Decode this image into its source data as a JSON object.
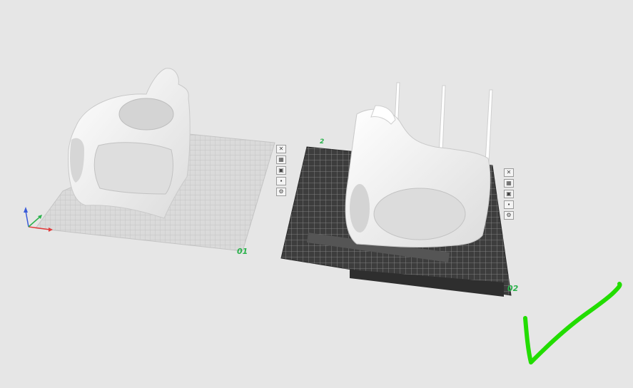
{
  "plates": [
    {
      "label": "01",
      "tools": [
        {
          "icon": "close-icon",
          "glyph": "✕"
        },
        {
          "icon": "arrange-icon",
          "glyph": "▦"
        },
        {
          "icon": "orient-icon",
          "glyph": "▣"
        },
        {
          "icon": "lock-icon",
          "glyph": "▪"
        },
        {
          "icon": "settings-icon",
          "glyph": "⚙"
        }
      ]
    },
    {
      "label": "02",
      "small_mark": "2",
      "tools": [
        {
          "icon": "close-icon",
          "glyph": "✕"
        },
        {
          "icon": "arrange-icon",
          "glyph": "▦"
        },
        {
          "icon": "orient-icon",
          "glyph": "▣"
        },
        {
          "icon": "lock-icon",
          "glyph": "▪"
        },
        {
          "icon": "settings-icon",
          "glyph": "⚙"
        }
      ]
    }
  ],
  "colors": {
    "background": "#e6e6e6",
    "plate_label": "#2bb24c",
    "checkmark": "#22dd00",
    "plate1_grid": "#d2d2d2",
    "plate2_surface": "#3c3c3c",
    "model": "#f5f5f5"
  }
}
